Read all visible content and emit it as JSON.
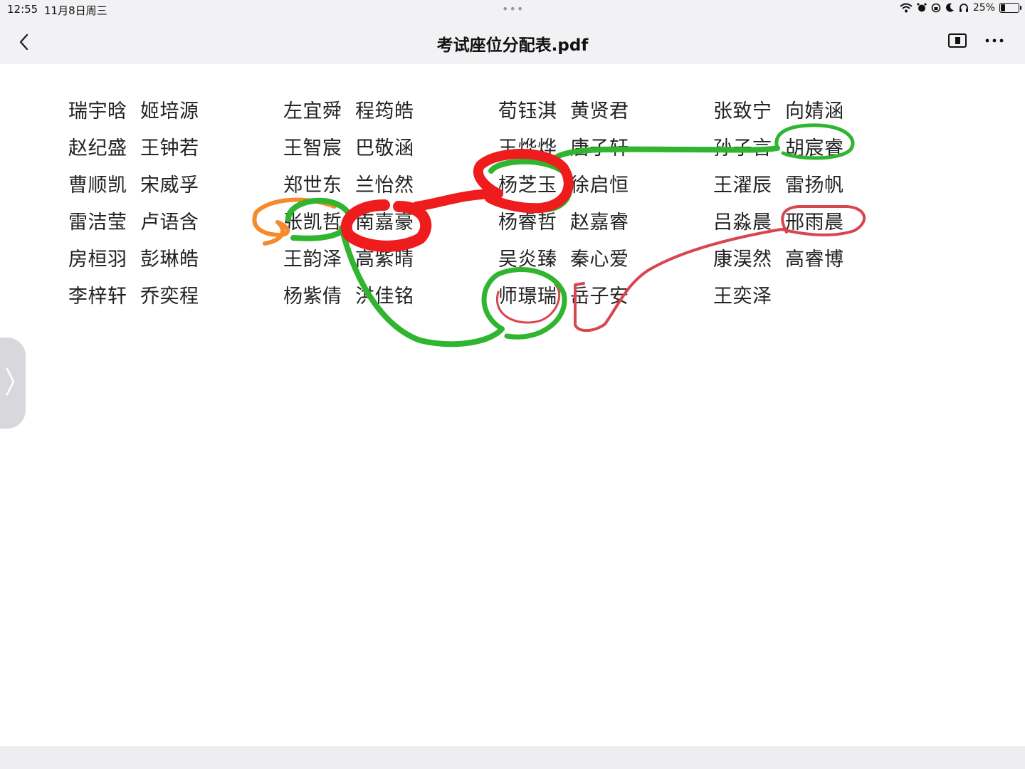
{
  "status_bar": {
    "time": "12:55",
    "date": "11月8日周三",
    "battery_text": "25%",
    "battery_level": 0.25,
    "icons": [
      "wifi-icon",
      "alarm-icon",
      "rotation-lock-icon",
      "moon-icon",
      "headphones-icon",
      "battery-icon"
    ]
  },
  "nav": {
    "title": "考试座位分配表.pdf",
    "back_icon": "chevron-left-icon",
    "panel_icon": "sidebar-panel-icon",
    "more_icon": "ellipsis-icon"
  },
  "seating": {
    "columns": [
      {
        "left": [
          "瑞宇晗",
          "赵纪盛",
          "曹顺凯",
          "雷洁莹",
          "房桓羽",
          "李梓轩"
        ],
        "right": [
          "姬培源",
          "王钟若",
          "宋威孚",
          "卢语含",
          "彭琳皓",
          "乔奕程"
        ]
      },
      {
        "left": [
          "左宜舜",
          "王智宸",
          "郑世东",
          "张凯哲",
          "王韵泽",
          "杨紫倩"
        ],
        "right": [
          "程筠皓",
          "巴敬涵",
          "兰怡然",
          "南嘉豪",
          "高紫晴",
          "洪佳铭"
        ]
      },
      {
        "left": [
          "荀钰淇",
          "王烨烨",
          "杨芝玉",
          "杨睿哲",
          "吴炎臻",
          "师璟瑞"
        ],
        "right": [
          "黄贤君",
          "唐子轩",
          "徐启恒",
          "赵嘉睿",
          "秦心爱",
          "岳子安"
        ]
      },
      {
        "left": [
          "张致宁",
          "孙子言",
          "王濯辰",
          "吕淼晨",
          "康淏然",
          "王奕泽"
        ],
        "right": [
          "向婧涵",
          "胡宸睿",
          "雷扬帆",
          "邢雨晨",
          "高睿博",
          ""
        ]
      }
    ]
  },
  "annotation_colors": {
    "green": "#2fb52f",
    "red": "#ee1c1c",
    "thin_red": "#d9454e",
    "orange": "#f58a2a"
  },
  "sidebar_tab_icon": "chevron-right-icon"
}
